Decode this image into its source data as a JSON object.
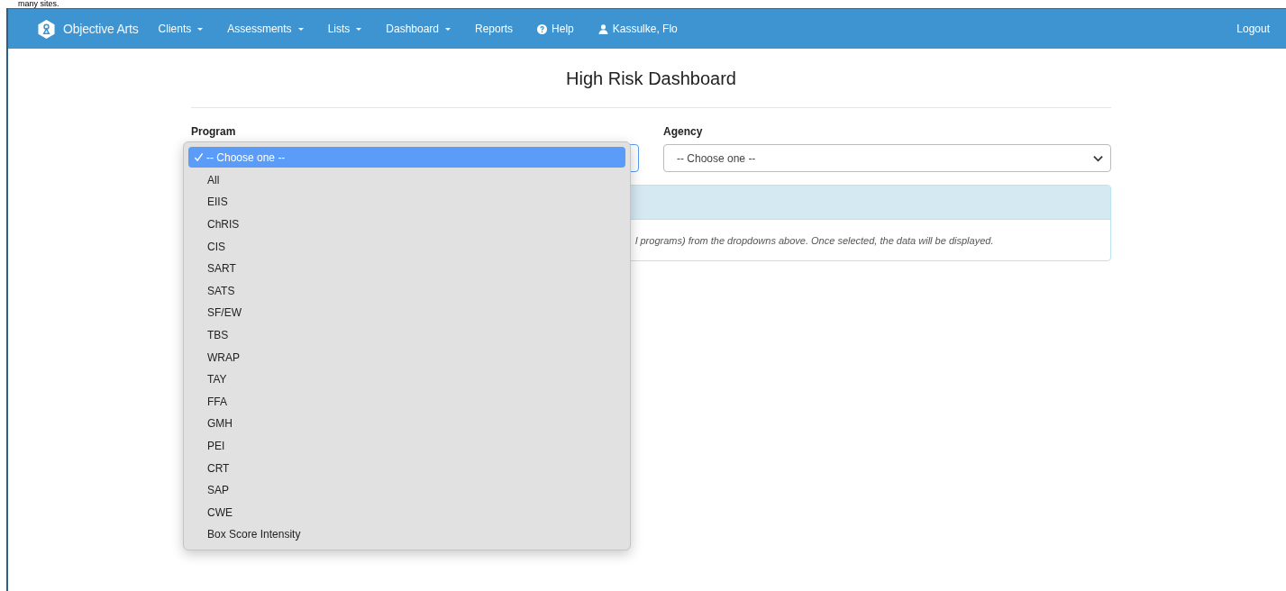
{
  "top_caption": "many sites.",
  "navbar": {
    "brand": "Objective Arts",
    "items": [
      {
        "label": "Clients",
        "kind": "dropdown"
      },
      {
        "label": "Assessments",
        "kind": "dropdown"
      },
      {
        "label": "Lists",
        "kind": "dropdown"
      },
      {
        "label": "Dashboard",
        "kind": "dropdown"
      },
      {
        "label": "Reports",
        "kind": "link"
      },
      {
        "label": "Help",
        "kind": "help"
      },
      {
        "label": "Kassulke, Flo",
        "kind": "user"
      }
    ],
    "logout": "Logout"
  },
  "page": {
    "title": "High Risk Dashboard",
    "program": {
      "label": "Program"
    },
    "agency": {
      "label": "Agency",
      "value": "-- Choose one --"
    },
    "program_menu": {
      "options": [
        {
          "label": "-- Choose one --",
          "selected": true
        },
        {
          "label": "All",
          "selected": false
        },
        {
          "label": "EIIS",
          "selected": false
        },
        {
          "label": "ChRIS",
          "selected": false
        },
        {
          "label": "CIS",
          "selected": false
        },
        {
          "label": "SART",
          "selected": false
        },
        {
          "label": "SATS",
          "selected": false
        },
        {
          "label": "SF/EW",
          "selected": false
        },
        {
          "label": "TBS",
          "selected": false
        },
        {
          "label": "WRAP",
          "selected": false
        },
        {
          "label": "TAY",
          "selected": false
        },
        {
          "label": "FFA",
          "selected": false
        },
        {
          "label": "GMH",
          "selected": false
        },
        {
          "label": "PEI",
          "selected": false
        },
        {
          "label": "CRT",
          "selected": false
        },
        {
          "label": "SAP",
          "selected": false
        },
        {
          "label": "CWE",
          "selected": false
        },
        {
          "label": "Box Score Intensity",
          "selected": false
        }
      ]
    },
    "info_panel": {
      "text": "l programs) from the dropdowns above. Once selected, the data will be displayed."
    }
  }
}
